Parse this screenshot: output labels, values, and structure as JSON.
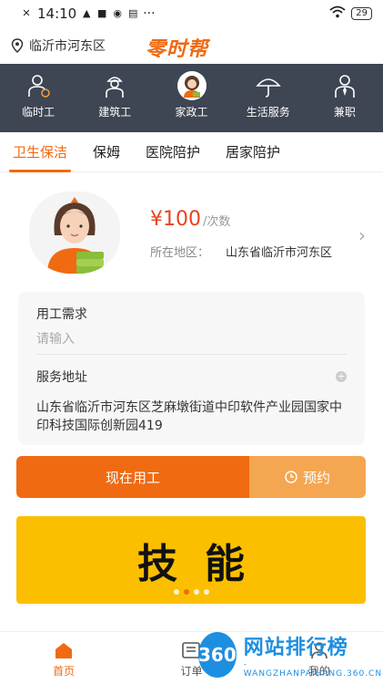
{
  "status_bar": {
    "time": "14:10",
    "battery": "29"
  },
  "header": {
    "location": "临沂市河东区",
    "brand": "零时帮"
  },
  "categories": [
    {
      "label": "临时工",
      "icon": "temp-worker-icon"
    },
    {
      "label": "建筑工",
      "icon": "construction-worker-icon"
    },
    {
      "label": "家政工",
      "icon": "housekeeper-icon"
    },
    {
      "label": "生活服务",
      "icon": "umbrella-icon"
    },
    {
      "label": "兼职",
      "icon": "part-time-icon"
    }
  ],
  "active_category": "家政工",
  "sub_tabs": [
    "卫生保洁",
    "保姆",
    "医院陪护",
    "居家陪护"
  ],
  "active_sub_tab": "卫生保洁",
  "service": {
    "price": "¥100",
    "unit": "/次数",
    "area_label": "所在地区：",
    "area_value": "山东省临沂市河东区"
  },
  "form": {
    "demand_label": "用工需求",
    "demand_placeholder": "请输入",
    "address_label": "服务地址",
    "address_value": "山东省临沂市河东区芝麻墩街道中印软件产业园国家中印科技国际创新园419"
  },
  "actions": {
    "now": "现在用工",
    "book": "预约"
  },
  "banner": {
    "text": "技能",
    "dots": 4,
    "active_dot": 1
  },
  "bottom_nav": [
    {
      "label": "首页",
      "icon": "home-icon"
    },
    {
      "label": "订单",
      "icon": "order-icon"
    },
    {
      "label": "我的",
      "icon": "profile-icon"
    }
  ],
  "watermark": {
    "badge": "360",
    "title": "网站排行榜",
    "sub": "-WANGZHANPAIHANG.360.CN-"
  },
  "colors": {
    "accent": "#f06a12",
    "nav_bg": "#3e4553",
    "banner": "#fbbf00",
    "price": "#e8431d"
  }
}
